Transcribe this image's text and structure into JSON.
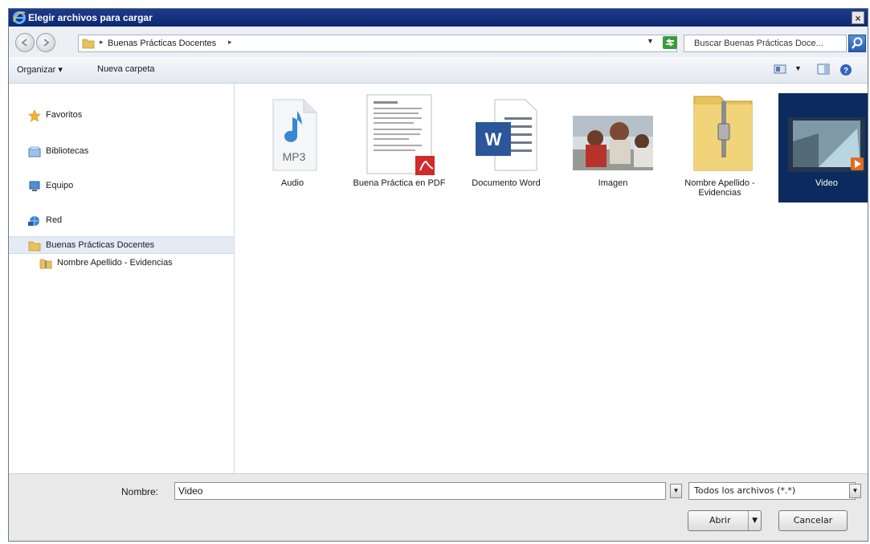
{
  "window": {
    "title": "Elegir archivos para cargar",
    "close_glyph": "×"
  },
  "address": {
    "breadcrumb": "Buenas Prácticas Docentes",
    "search_placeholder": "Buscar Buenas Prácticas Doce..."
  },
  "toolbar": {
    "organize_label": "Organizar ▾",
    "new_folder_label": "Nueva carpeta"
  },
  "sidebar": {
    "items": [
      {
        "label": "Favoritos",
        "icon": "star-icon"
      },
      {
        "label": "Bibliotecas",
        "icon": "library-icon"
      },
      {
        "label": "Equipo",
        "icon": "computer-icon"
      },
      {
        "label": "Red",
        "icon": "network-icon"
      },
      {
        "label": "Buenas Prácticas Docentes",
        "icon": "folder-icon"
      },
      {
        "label": "Nombre Apellido - Evidencias",
        "icon": "zip-folder-icon"
      }
    ],
    "selected_index": 4
  },
  "files": [
    {
      "name": "Audio",
      "type": "mp3",
      "badge": "MP3"
    },
    {
      "name": "Buena Práctica en PDF",
      "type": "pdf"
    },
    {
      "name": "Documento Word",
      "type": "word",
      "badge": "W"
    },
    {
      "name": "Imagen",
      "type": "image"
    },
    {
      "name": "Nombre Apellido - Evidencias",
      "type": "zip"
    },
    {
      "name": "Video",
      "type": "video",
      "selected": true
    }
  ],
  "footer": {
    "name_label": "Nombre:",
    "name_value": "Video",
    "filter_value": "Todos los archivos (*.*)",
    "open_label": "Abrir",
    "cancel_label": "Cancelar"
  },
  "colors": {
    "title_bar": "#0b2a74",
    "selection": "#0b2b5e",
    "sidebar_selection": "#e4ebf5"
  }
}
